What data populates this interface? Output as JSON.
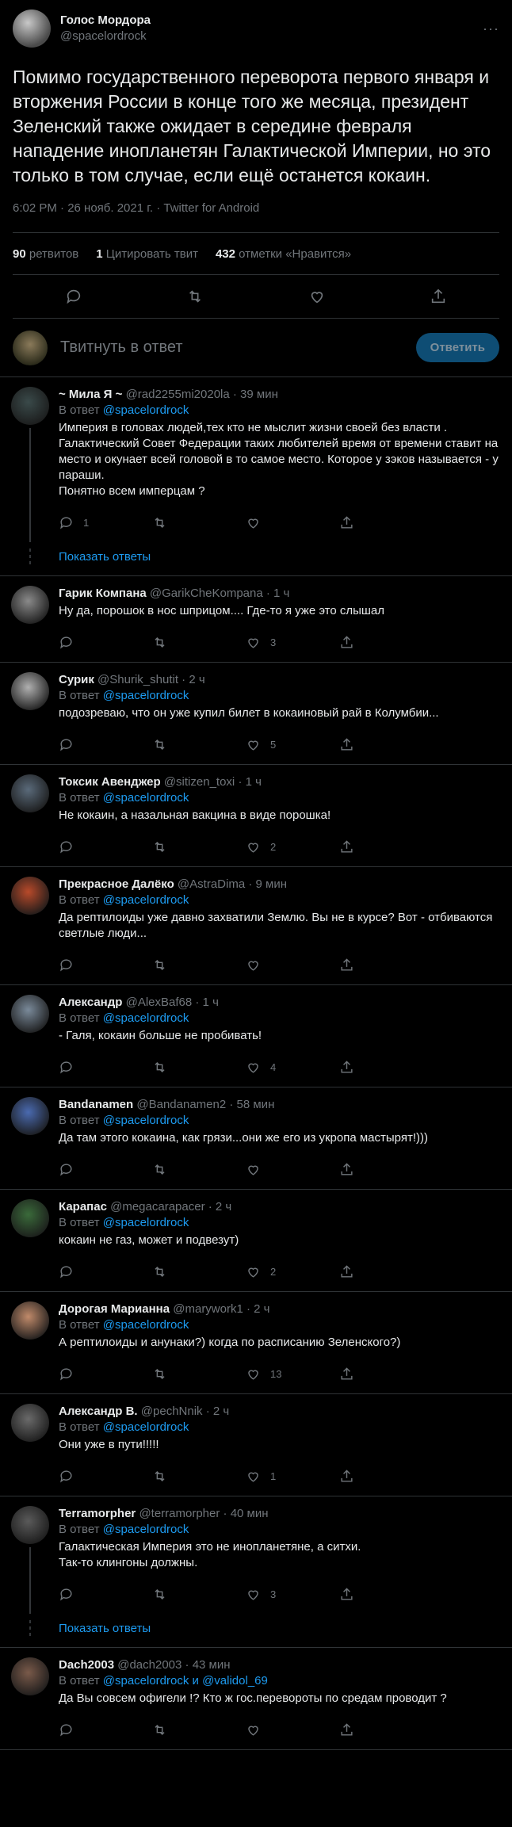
{
  "main": {
    "display_name": "Голос Мордора",
    "handle": "@spacelordrock",
    "text": "Помимо государственного переворота первого января и вторжения России в конце того же месяца, президент Зеленский также ожидает в середине февраля нападение инопланетян Галактической Империи, но это только в том случае, если ещё останется кокаин.",
    "time": "6:02 PM · 26 нояб. 2021 г. · Twitter for Android",
    "retweets_count": "90",
    "retweets_label": "ретвитов",
    "quotes_count": "1",
    "quotes_label": "Цитировать твит",
    "likes_count": "432",
    "likes_label": "отметки «Нравится»"
  },
  "composer": {
    "placeholder": "Твитнуть в ответ",
    "button": "Ответить"
  },
  "replying_prefix": "В ответ",
  "show_replies": "Показать ответы",
  "replies": [
    {
      "name": "~ Мила Я ~",
      "handle": "@rad2255mi2020la",
      "time": "· 39 мин",
      "to": "@spacelordrock",
      "lines": [
        "Империя  в головах людей,тех кто не мыслит жизни своей без власти . Галактический Совет Федерации таких любителей время от времени ставит на место и окунает всей головой в то самое место. Которое у зэков называется - у параши.",
        "Понятно всем имперцам ?"
      ],
      "reply_count": "1",
      "retweet_count": "",
      "like_count": ""
    },
    {
      "name": "Гарик Компана",
      "handle": "@GarikCheKompana",
      "time": "· 1 ч",
      "to": "",
      "lines": [
        "Ну да, порошок в нос шприцом.... Где-то я уже это слышал"
      ],
      "reply_count": "",
      "retweet_count": "",
      "like_count": "3"
    },
    {
      "name": "Сурик",
      "handle": "@Shurik_shutit",
      "time": "· 2 ч",
      "to": "@spacelordrock",
      "lines": [
        "подозреваю, что он уже купил билет в кокаиновый рай в Колумбии..."
      ],
      "reply_count": "",
      "retweet_count": "",
      "like_count": "5"
    },
    {
      "name": "Токсик Авенджер",
      "handle": "@sitizen_toxi",
      "time": "· 1 ч",
      "to": "@spacelordrock",
      "lines": [
        "Не кокаин, а назальная вакцина в виде порошка!"
      ],
      "reply_count": "",
      "retweet_count": "",
      "like_count": "2"
    },
    {
      "name": "Прекрасное Далёко",
      "handle": "@AstraDima",
      "time": "· 9 мин",
      "to": "@spacelordrock",
      "lines": [
        "Да рептилоиды уже давно захватили Землю. Вы не в курсе? Вот - отбиваются светлые люди..."
      ],
      "reply_count": "",
      "retweet_count": "",
      "like_count": ""
    },
    {
      "name": "Александр",
      "handle": "@AlexBaf68",
      "time": "· 1 ч",
      "to": "@spacelordrock",
      "lines": [
        "- Галя, кокаин больше не пробивать!"
      ],
      "reply_count": "",
      "retweet_count": "",
      "like_count": "4"
    },
    {
      "name": "Bandanamen",
      "handle": "@Bandanamen2",
      "time": "· 58 мин",
      "to": "@spacelordrock",
      "lines": [
        "Да там этого кокаина, как грязи...они же его из укропа мастырят!)))"
      ],
      "reply_count": "",
      "retweet_count": "",
      "like_count": ""
    },
    {
      "name": "Карапас",
      "handle": "@megacarapacer",
      "time": "· 2 ч",
      "to": "@spacelordrock",
      "lines": [
        "кокаин не газ, может и подвезут)"
      ],
      "reply_count": "",
      "retweet_count": "",
      "like_count": "2"
    },
    {
      "name": "Дорогая Марианна",
      "handle": "@marywork1",
      "time": "· 2 ч",
      "to": "@spacelordrock",
      "lines": [
        "А рептилоиды и анунаки?) когда по расписанию Зеленского?)"
      ],
      "reply_count": "",
      "retweet_count": "",
      "like_count": "13"
    },
    {
      "name": "Александр В.",
      "handle": "@pechNnik",
      "time": "· 2 ч",
      "to": "@spacelordrock",
      "lines": [
        "Они уже в пути!!!!!"
      ],
      "reply_count": "",
      "retweet_count": "",
      "like_count": "1"
    },
    {
      "name": "Terramorpher",
      "handle": "@terramorpher",
      "time": "· 40 мин",
      "to": "@spacelordrock",
      "lines": [
        "Галактическая Империя это не инопланетяне, а ситхи.",
        "Так-то клингоны должны."
      ],
      "reply_count": "",
      "retweet_count": "",
      "like_count": "3"
    },
    {
      "name": "Dach2003",
      "handle": "@dach2003",
      "time": "· 43 мин",
      "to": "@spacelordrock и @validol_69",
      "lines": [
        "Да Вы совсем офигели !? Кто ж гос.перевороты по средам проводит ?"
      ],
      "reply_count": "",
      "retweet_count": "",
      "like_count": ""
    }
  ],
  "avatar_colors": [
    "#3a4a4a",
    "#8a8a8a",
    "#b0b0b0",
    "#5a6a7a",
    "#b84a2a",
    "#7a8a9a",
    "#4a6ab0",
    "#3a6a3a",
    "#c08a6a",
    "#6a6a6a",
    "#5a5a5a",
    "#7a5a4a"
  ]
}
